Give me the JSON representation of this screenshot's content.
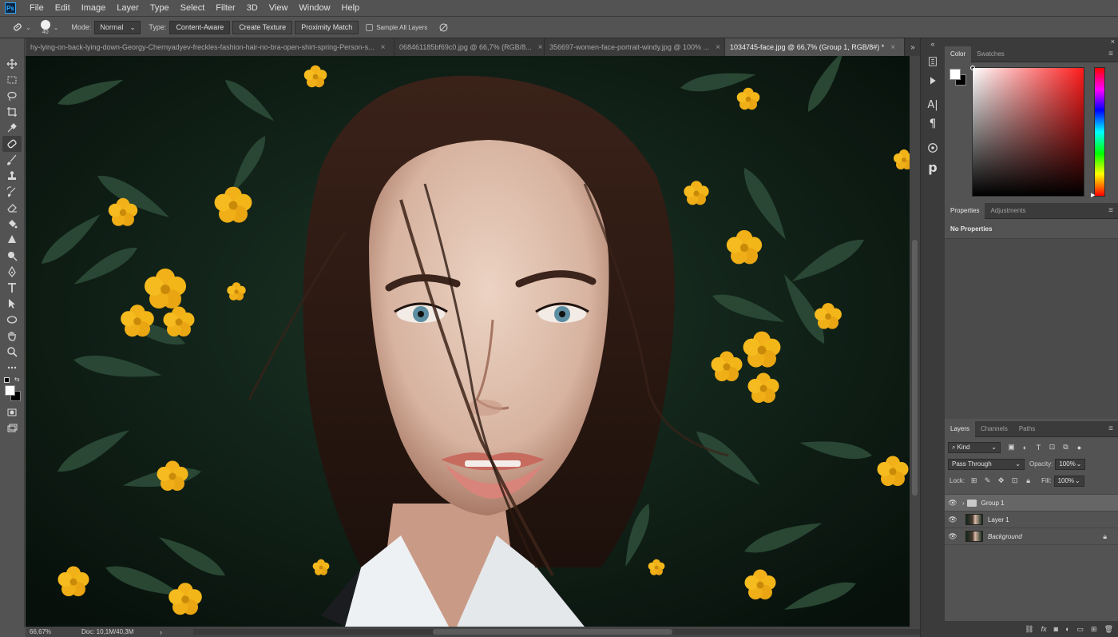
{
  "app": {
    "logo": "Ps",
    "menu": [
      "File",
      "Edit",
      "Image",
      "Layer",
      "Type",
      "Select",
      "Filter",
      "3D",
      "View",
      "Window",
      "Help"
    ]
  },
  "options": {
    "brush_size": "40",
    "mode_label": "Mode:",
    "mode_value": "Normal",
    "type_label": "Type:",
    "type_buttons": [
      "Content-Aware",
      "Create Texture",
      "Proximity Match"
    ],
    "sample_all_layers": "Sample All Layers"
  },
  "tabs": [
    {
      "label": "hy-lying-on-back-lying-down-Georgy-Chernyadyev-freckles-fashion-hair-no-bra-open-shirt-spring-Person-s...",
      "close": "×"
    },
    {
      "label": "068461185bf69c0.jpg @ 66,7% (RGB/8...",
      "close": "×"
    },
    {
      "label": "356697-women-face-portrait-windy.jpg @ 100% ...",
      "close": "×"
    },
    {
      "label": "1034745-face.jpg @ 66,7% (Group 1, RGB/8#) *",
      "close": "×"
    }
  ],
  "status": {
    "zoom": "66,67%",
    "doc": "Doc: 10,1M/40,3M"
  },
  "panels": {
    "color": {
      "tabs": [
        "Color",
        "Swatches"
      ],
      "foreground": "#ffffff",
      "background": "#000000"
    },
    "properties": {
      "tabs": [
        "Properties",
        "Adjustments"
      ],
      "text": "No Properties"
    },
    "layers": {
      "tabs": [
        "Layers",
        "Channels",
        "Paths"
      ],
      "kind": "Kind",
      "blend_mode": "Pass Through",
      "opacity_label": "Opacity:",
      "opacity_value": "100%",
      "lock_label": "Lock:",
      "fill_label": "Fill:",
      "fill_value": "100%",
      "items": [
        {
          "name": "Group 1",
          "type": "group"
        },
        {
          "name": "Layer 1",
          "type": "layer"
        },
        {
          "name": "Background",
          "type": "background"
        }
      ]
    }
  }
}
